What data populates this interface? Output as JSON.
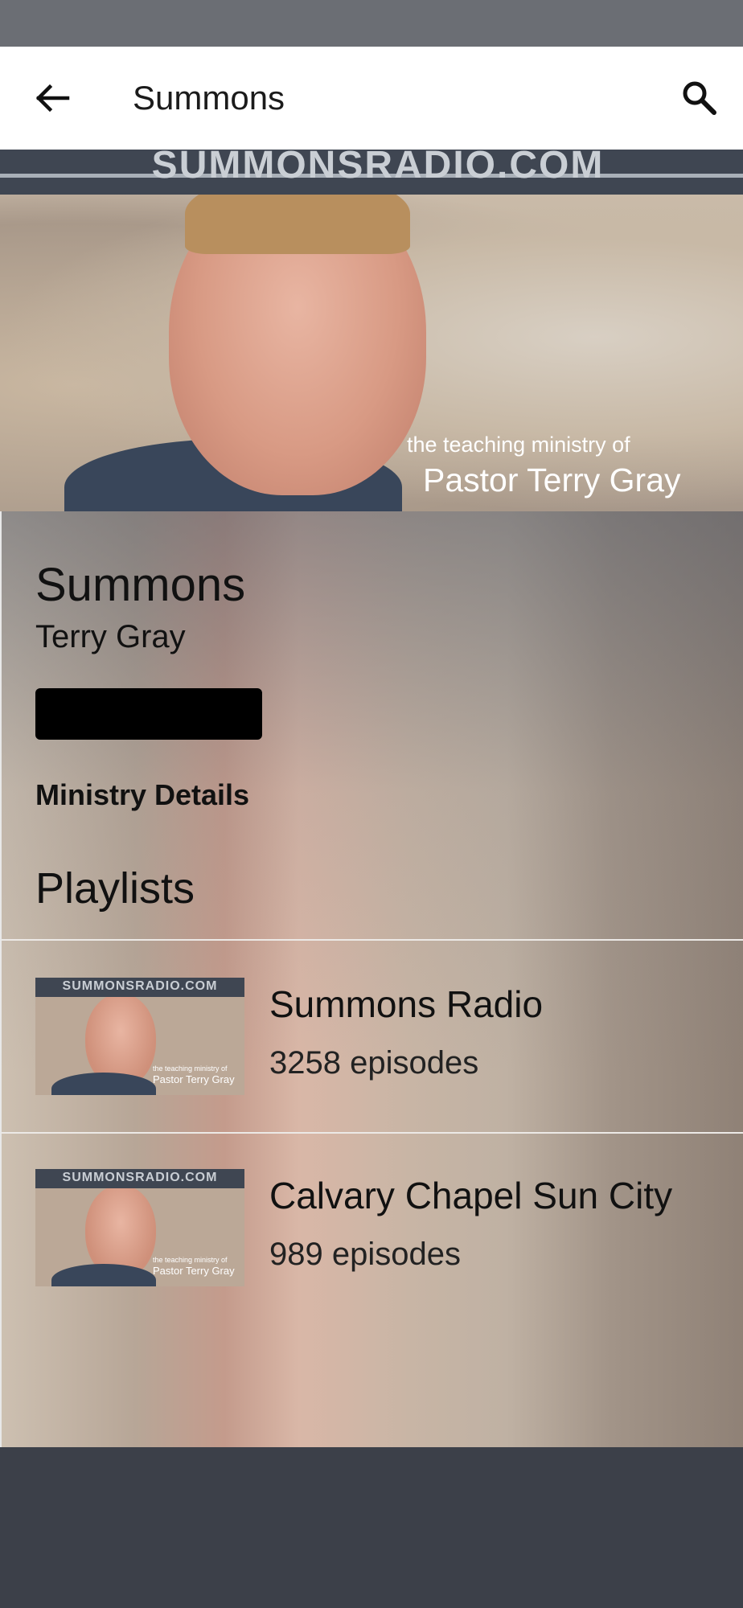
{
  "app_bar": {
    "title": "Summons",
    "back_icon": "arrow-left-icon",
    "search_icon": "search-icon"
  },
  "hero": {
    "banner_text": "SUMMONSRADIO.COM",
    "caption_small": "the teaching ministry of",
    "caption_big": "Pastor Terry Gray"
  },
  "podcast": {
    "title": "Summons",
    "author": "Terry Gray",
    "subscribe_label": "",
    "ministry_details": "Ministry Details",
    "playlists_heading": "Playlists"
  },
  "playlists": [
    {
      "title": "Summons Radio",
      "episodes": "3258 episodes",
      "thumb_banner": "SUMMONSRADIO.COM",
      "thumb_caption_small": "the teaching ministry of",
      "thumb_caption_big": "Pastor Terry Gray"
    },
    {
      "title": "Calvary Chapel Sun City",
      "episodes": "989 episodes",
      "thumb_banner": "SUMMONSRADIO.COM",
      "thumb_caption_small": "the teaching ministry of",
      "thumb_caption_big": "Pastor Terry Gray"
    }
  ],
  "colors": {
    "status_bar": "#6b6e74",
    "app_bar": "#ffffff",
    "background": "#3c4049",
    "button": "#000000"
  }
}
